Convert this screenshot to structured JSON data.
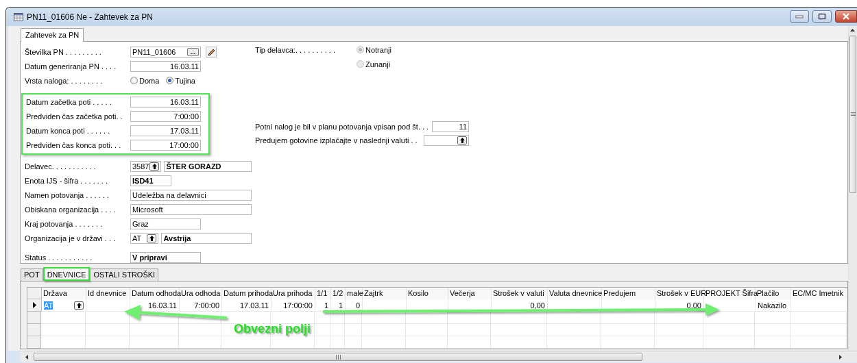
{
  "window": {
    "title": "PN11_01606 Ne - Zahtevek za PN"
  },
  "form_tabs": [
    {
      "label": "Zahtevek za PN",
      "selected": true
    }
  ],
  "sections": [
    {
      "fields": [
        {
          "kind": "lookup",
          "label": "Številka PN . . . . . . . . .",
          "value": "PN11_01606",
          "button": "...",
          "editable": true
        },
        {
          "kind": "number",
          "label": "Datum generiranja PN . . . .",
          "value": "16.03.11"
        },
        {
          "kind": "radio",
          "label": "Vrsta naloga: . . . . . . . .",
          "options": [
            {
              "label": "Doma",
              "selected": false
            },
            {
              "label": "Tujina",
              "selected": true
            }
          ]
        }
      ]
    },
    {
      "highlight_frame": true,
      "fields": [
        {
          "kind": "number",
          "label": "Datum začetka poti . . . . .",
          "value": "16.03.11"
        },
        {
          "kind": "number",
          "label": "Predviden čas začetka poti. .",
          "value": "7:00:00"
        },
        {
          "kind": "number",
          "label": "Datum konca poti . . . . . .",
          "value": "17.03.11"
        },
        {
          "kind": "number",
          "label": "Predviden čas konca poti. . .",
          "value": "17:00:00"
        }
      ]
    },
    {
      "fields": [
        {
          "kind": "code_name",
          "label": "Delavec. . . . . . . . . . .",
          "value": "3587",
          "name": "ŠTER GORAZD"
        },
        {
          "kind": "code",
          "label": "Enota IJS - šifra . . . . . . .",
          "value": "ISD41"
        },
        {
          "kind": "long_text",
          "label": "Namen potovanja . . . . . .",
          "value": "Udeležba na delavnici"
        },
        {
          "kind": "long_text",
          "label": "Obiskana organizacija . . . .",
          "value": "Microsoft"
        },
        {
          "kind": "short_text",
          "label": "Kraj potovanja . . . . . . .",
          "value": "Graz"
        },
        {
          "kind": "country",
          "label": "Organizacija je v državi . . .",
          "value": "AT",
          "name": "Avstrija"
        },
        {
          "kind": "status",
          "label": "Status . . . . . . . . . . .",
          "value": "V pripravi"
        }
      ]
    }
  ],
  "worker_type": {
    "label": "Tip delavca:. . . . . . . . . .",
    "disabled": true,
    "options": [
      {
        "label": "Notranji",
        "selected": true
      },
      {
        "label": "Zunanji",
        "selected": false
      }
    ]
  },
  "right_fields": [
    {
      "kind": "number",
      "label": "Potni nalog je bil v planu potovanja vpisan pod št. . .",
      "value": "11"
    },
    {
      "kind": "lookup_empty",
      "label": "Predujem gotovine izplačajte v naslednji valuti . ."
    }
  ],
  "lines_tabs": [
    {
      "label": "POT",
      "selected": false,
      "framed": false
    },
    {
      "label": "DNEVNICE",
      "selected": true,
      "framed": true
    },
    {
      "label": "OSTALI STROŠKI",
      "selected": false,
      "framed": false
    }
  ],
  "table": {
    "columns": [
      {
        "label": "Država",
        "kind": "lookup"
      },
      {
        "label": "Id dnevnice",
        "kind": "text"
      },
      {
        "label": "Datum odhoda",
        "kind": "number"
      },
      {
        "label": "Ura odhoda",
        "kind": "number"
      },
      {
        "label": "Datum prihoda",
        "kind": "number"
      },
      {
        "label": "Ura prihoda",
        "kind": "number"
      },
      {
        "label": "1/1",
        "kind": "number"
      },
      {
        "label": "1/2",
        "kind": "number"
      },
      {
        "label": "male",
        "kind": "number"
      },
      {
        "label": "Zajtrk",
        "kind": "text"
      },
      {
        "label": "Kosilo",
        "kind": "text"
      },
      {
        "label": "Večerja",
        "kind": "text"
      },
      {
        "label": "Strošek v valuti",
        "kind": "number"
      },
      {
        "label": "Valuta dnevnice",
        "kind": "text"
      },
      {
        "label": "Predujem",
        "kind": "text"
      },
      {
        "label": "Strošek v EUR",
        "kind": "number"
      },
      {
        "label": "PROJEKT Šifra",
        "kind": "text"
      },
      {
        "label": "Plačilo",
        "kind": "text"
      },
      {
        "label": "EC/MC Imetnik",
        "kind": "text"
      }
    ],
    "rows": [
      {
        "current": true,
        "first_value_selected": true,
        "cells": [
          "AT",
          "",
          "16.03.11",
          "7:00:00",
          "17.03.11",
          "17:00:00",
          "1",
          "1",
          "0",
          "",
          "",
          "",
          "0,00",
          "",
          "",
          "0,00",
          "",
          "Nakazilo",
          ""
        ]
      }
    ]
  },
  "annotation": {
    "label": "Obvezni polji"
  }
}
